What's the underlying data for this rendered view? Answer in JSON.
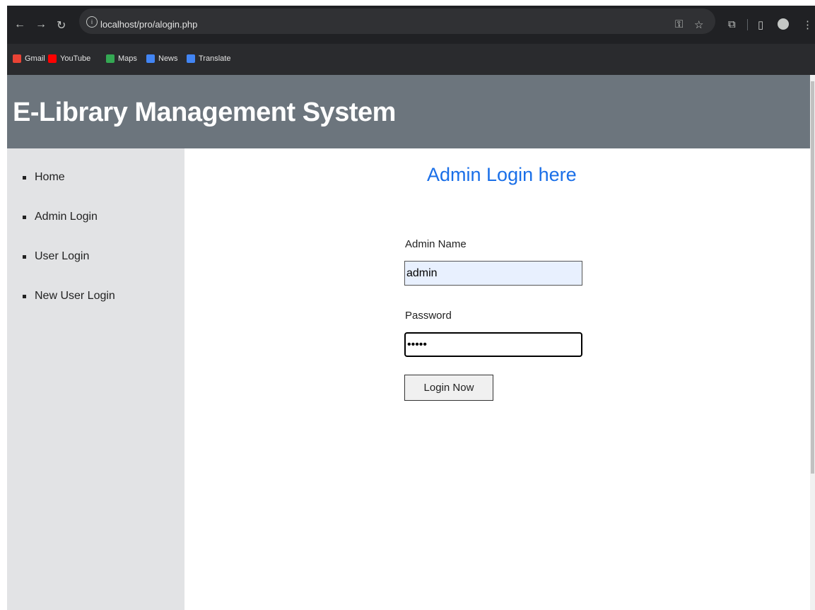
{
  "browser": {
    "url": "localhost/pro/alogin.php",
    "bookmarks": [
      {
        "label": "Gmail",
        "icon": "gmail-icon",
        "color": "#ea4335"
      },
      {
        "label": "YouTube",
        "icon": "youtube-icon",
        "color": "#ff0000"
      },
      {
        "label": "Maps",
        "icon": "maps-icon",
        "color": "#34a853"
      },
      {
        "label": "News",
        "icon": "news-icon",
        "color": "#4285f4"
      },
      {
        "label": "Translate",
        "icon": "translate-icon",
        "color": "#4285f4"
      }
    ]
  },
  "site": {
    "title": "E-Library Management System"
  },
  "sidebar": {
    "items": [
      {
        "label": "Home"
      },
      {
        "label": "Admin Login"
      },
      {
        "label": "User Login"
      },
      {
        "label": "New User Login"
      }
    ]
  },
  "login": {
    "title": "Admin Login here",
    "name_label": "Admin Name",
    "name_value": "admin",
    "password_label": "Password",
    "password_value": "•••••",
    "button_label": "Login Now"
  },
  "colors": {
    "header": "#6c757d",
    "sidebar": "#e2e3e5",
    "title_accent": "#1a6fe8"
  }
}
